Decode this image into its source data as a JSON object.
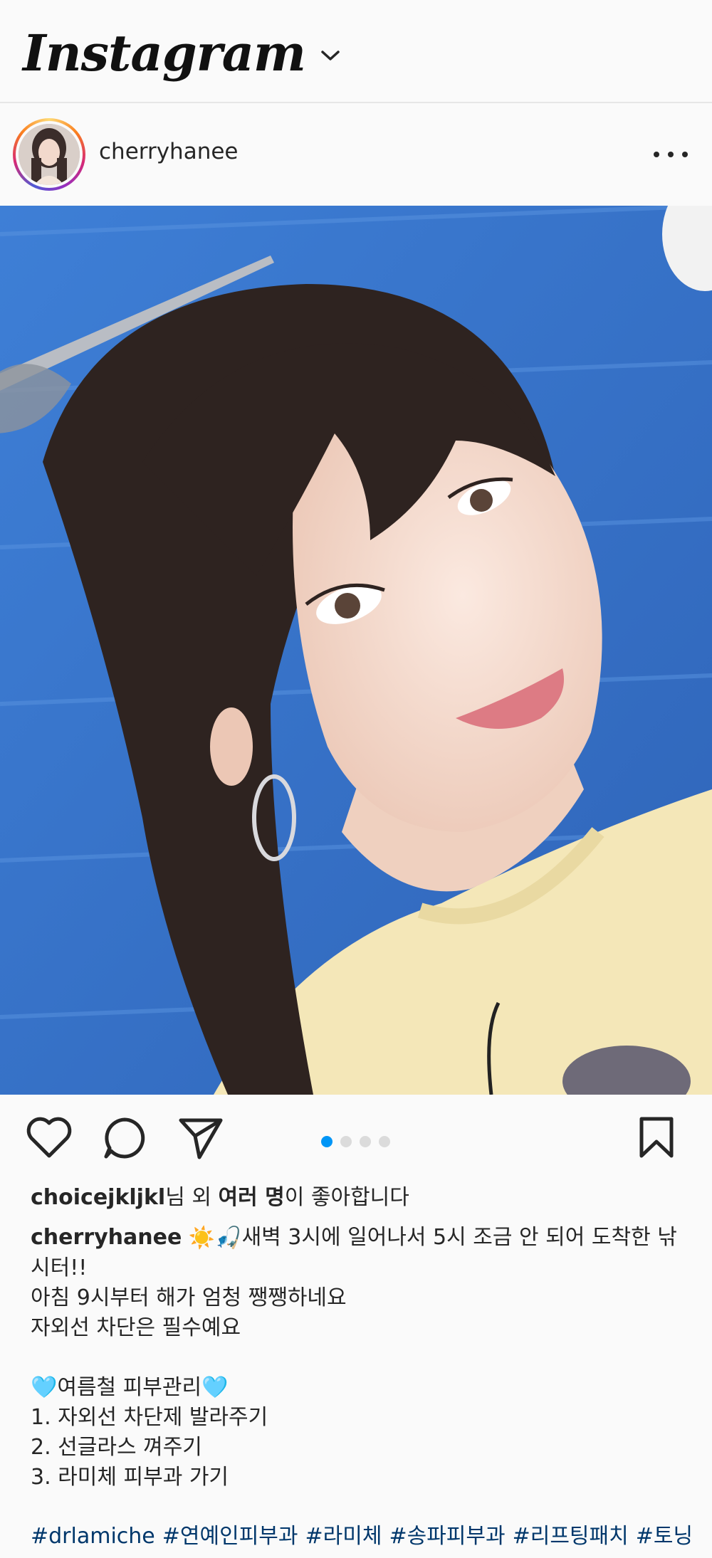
{
  "app": {
    "name": "Instagram",
    "colors": {
      "accent": "#0095f6",
      "text": "#262626",
      "link": "#00376b",
      "background": "#fafafa"
    }
  },
  "header": {
    "logo_text": "Instagram",
    "switch_icon": "chevron-down-icon"
  },
  "post": {
    "username": "cherryhanee",
    "more_icon": "more-horizontal-icon",
    "photo_alt": "selfie photo",
    "carousel": {
      "count": 4,
      "active_index": 0
    }
  },
  "actions": {
    "like_icon": "heart-icon",
    "comment_icon": "comment-icon",
    "share_icon": "paper-plane-icon",
    "save_icon": "bookmark-icon"
  },
  "likes": {
    "user": "choicejkljkl",
    "text_middle": "님 외 ",
    "others": "여러 명",
    "text_end": "이 좋아합니다"
  },
  "caption": {
    "username": "cherryhanee",
    "line1": "새벽 3시에 일어나서 5시 조금 안 되어 도착한 낚",
    "line2": "시터!!",
    "line3": "아침 9시부터 해가 엄청 쨍쨍하네요",
    "line4": "자외선 차단은 필수예요",
    "line5": "여름철 피부관리",
    "line6": "1. 자외선 차단제 발라주기",
    "line7": "2. 선글라스 껴주기",
    "line8": "3. 라미체 피부과 가기"
  },
  "hashtags": [
    "#drlamiche",
    "#연예인피부과",
    "#라미체",
    "#송파피부과",
    "#리프팅패치",
    "#토닝"
  ]
}
